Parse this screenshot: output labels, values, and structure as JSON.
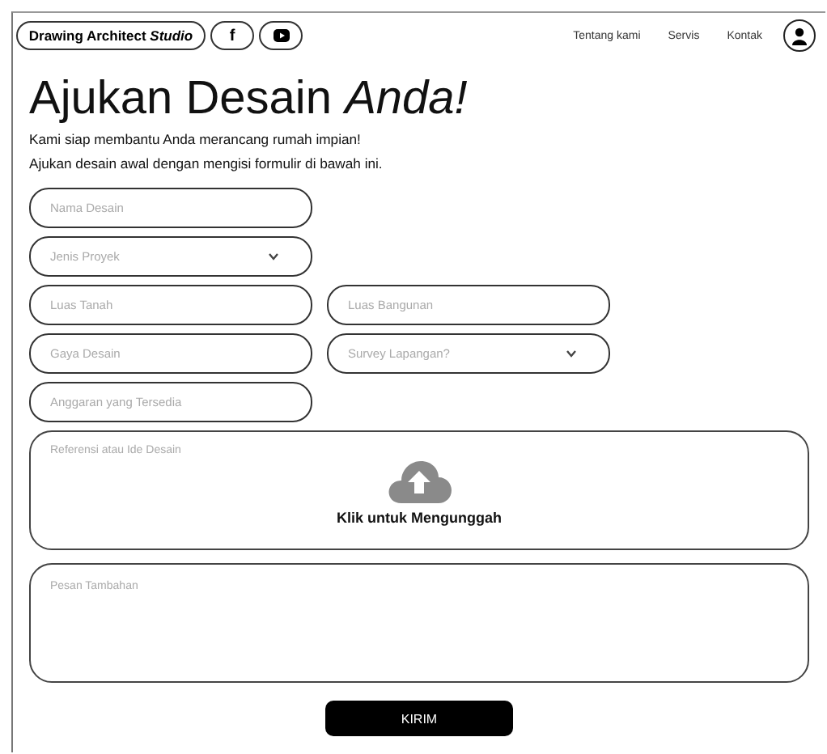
{
  "header": {
    "brand": "Drawing Architect *Studio*",
    "social": [
      {
        "kind": "facebook",
        "label": "f"
      },
      {
        "kind": "youtube"
      }
    ],
    "nav": [
      "Tentang kami",
      "Servis",
      "Kontak"
    ]
  },
  "title": "Ajukan Desain *Anda!*",
  "intro": [
    "Kami siap membantu Anda merancang rumah impian!",
    "Ajukan desain awal dengan mengisi formulir di bawah ini."
  ],
  "form_rows": [
    [
      {
        "kind": "text",
        "placeholder": "Nama Desain"
      }
    ],
    [
      {
        "kind": "select",
        "placeholder": "Jenis Proyek"
      }
    ],
    [
      {
        "kind": "text",
        "placeholder": "Luas Tanah"
      },
      {
        "kind": "text",
        "placeholder": "Luas Bangunan"
      }
    ],
    [
      {
        "kind": "text",
        "placeholder": "Gaya Desain"
      },
      {
        "kind": "select",
        "placeholder": "Survey Lapangan?"
      }
    ],
    [
      {
        "kind": "text",
        "placeholder": "Anggaran yang Tersedia"
      }
    ]
  ],
  "upload": {
    "label": "Referensi atau Ide Desain",
    "action": "Klik untuk Mengunggah"
  },
  "message": {
    "placeholder": "Pesan Tambahan"
  },
  "submit": "KIRIM"
}
